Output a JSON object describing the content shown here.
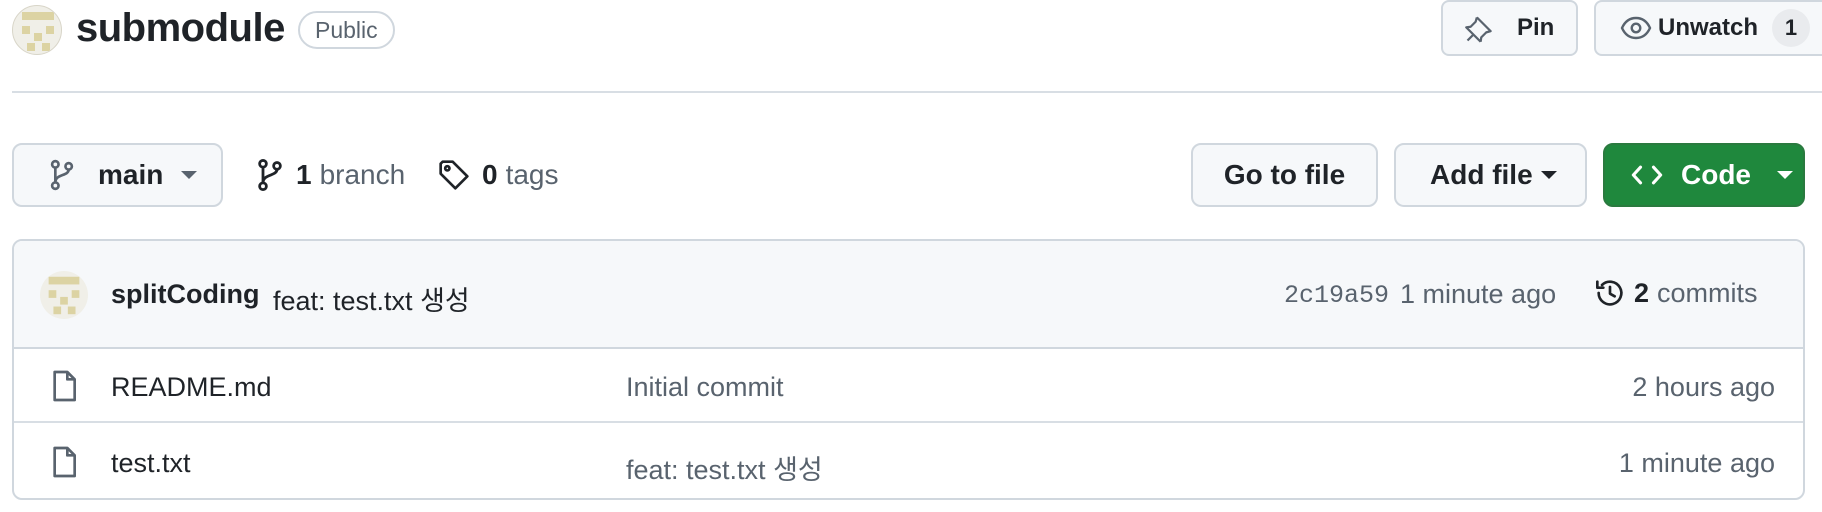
{
  "repo": {
    "name": "submodule",
    "visibility": "Public"
  },
  "actions": {
    "pin_label": "Pin",
    "watch_label": "Unwatch",
    "watch_count": "1"
  },
  "toolbar": {
    "branch_name": "main",
    "branch_count": "1",
    "branch_word": "branch",
    "tag_count": "0",
    "tag_word": "tags",
    "goto_file_label": "Go to file",
    "add_file_label": "Add file",
    "code_label": "Code"
  },
  "latest_commit": {
    "author": "splitCoding",
    "message": "feat: test.txt 생성",
    "sha": "2c19a59",
    "age": "1 minute ago",
    "commit_count": "2",
    "commit_word": "commits"
  },
  "files": [
    {
      "name": "README.md",
      "commit_message": "Initial commit",
      "age": "2 hours ago",
      "icon": "file-icon"
    },
    {
      "name": "test.txt",
      "commit_message": "feat: test.txt 생성",
      "age": "1 minute ago",
      "icon": "file-icon"
    }
  ],
  "colors": {
    "code_button": "#1f883d",
    "muted_text": "#59636e",
    "border": "#d0d7de",
    "avatar_accent": "#dcd3a3"
  }
}
